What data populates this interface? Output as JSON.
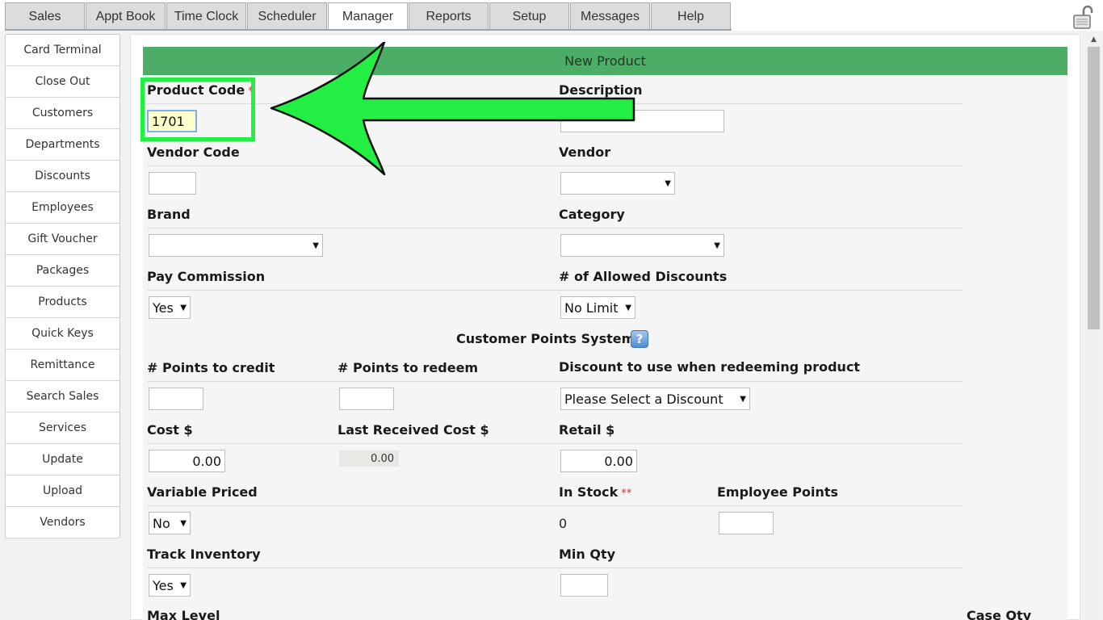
{
  "nav": {
    "tabs": [
      {
        "label": "Sales",
        "active": false
      },
      {
        "label": "Appt Book",
        "active": false
      },
      {
        "label": "Time Clock",
        "active": false
      },
      {
        "label": "Scheduler",
        "active": false
      },
      {
        "label": "Manager",
        "active": true
      },
      {
        "label": "Reports",
        "active": false
      },
      {
        "label": "Setup",
        "active": false
      },
      {
        "label": "Messages",
        "active": false
      },
      {
        "label": "Help",
        "active": false
      }
    ],
    "lock_icon": "unlocked-padlock-icon"
  },
  "sidebar": {
    "items": [
      {
        "label": "Card Terminal"
      },
      {
        "label": "Close Out"
      },
      {
        "label": "Customers"
      },
      {
        "label": "Departments"
      },
      {
        "label": "Discounts"
      },
      {
        "label": "Employees"
      },
      {
        "label": "Gift Voucher"
      },
      {
        "label": "Packages"
      },
      {
        "label": "Products"
      },
      {
        "label": "Quick Keys"
      },
      {
        "label": "Remittance"
      },
      {
        "label": "Search Sales"
      },
      {
        "label": "Services"
      },
      {
        "label": "Update"
      },
      {
        "label": "Upload"
      },
      {
        "label": "Vendors"
      }
    ]
  },
  "form": {
    "title": "New Product",
    "product_code": {
      "label": "Product Code",
      "required_mark": "*",
      "value": "1701"
    },
    "description": {
      "label": "Description",
      "value": ""
    },
    "vendor_code": {
      "label": "Vendor Code",
      "value": ""
    },
    "vendor": {
      "label": "Vendor",
      "value": ""
    },
    "brand": {
      "label": "Brand",
      "value": ""
    },
    "category": {
      "label": "Category",
      "value": ""
    },
    "pay_commission": {
      "label": "Pay Commission",
      "value": "Yes"
    },
    "allowed_discounts": {
      "label": "# of Allowed Discounts",
      "value": "No Limit"
    },
    "points_section": {
      "title": "Customer Points System",
      "help_icon": "?"
    },
    "points_credit": {
      "label": "# Points to credit",
      "value": ""
    },
    "points_redeem": {
      "label": "# Points to redeem",
      "value": ""
    },
    "redeem_discount": {
      "label": "Discount to use when redeeming product",
      "value": "Please Select a Discount"
    },
    "cost": {
      "label": "Cost $",
      "value": "0.00"
    },
    "last_received_cost": {
      "label": "Last Received Cost $",
      "value": "0.00"
    },
    "retail": {
      "label": "Retail $",
      "value": "0.00"
    },
    "variable_priced": {
      "label": "Variable Priced",
      "value": "No"
    },
    "in_stock": {
      "label": "In Stock",
      "required_mark": "**",
      "value": "0"
    },
    "employee_points": {
      "label": "Employee Points",
      "value": ""
    },
    "track_inventory": {
      "label": "Track Inventory",
      "value": "Yes"
    },
    "min_qty": {
      "label": "Min Qty",
      "value": ""
    },
    "max_level": {
      "label": "Max Level"
    },
    "case_qty": {
      "label": "Case Qty"
    }
  },
  "colors": {
    "banner": "#4cad66",
    "annotation": "#22ee44",
    "required": "#c0392b"
  }
}
